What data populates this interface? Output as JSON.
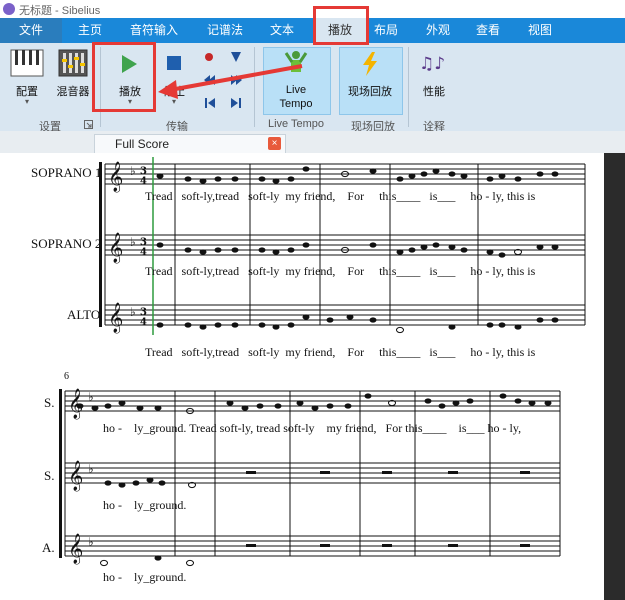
{
  "window": {
    "title": "无标题 - Sibelius"
  },
  "menubar": {
    "tabs": [
      {
        "label": "文件"
      },
      {
        "label": "主页"
      },
      {
        "label": "音符输入"
      },
      {
        "label": "记谱法"
      },
      {
        "label": "文本"
      },
      {
        "label": "播放"
      },
      {
        "label": "布局"
      },
      {
        "label": "外观"
      },
      {
        "label": "查看"
      },
      {
        "label": "视图"
      }
    ],
    "active": "播放"
  },
  "ribbon": {
    "config_label": "配置",
    "mixer_label": "混音器",
    "play_label": "播放",
    "stop_label": "停止",
    "live_tempo_label": "Live\nTempo",
    "live_playback_label": "现场回放",
    "performance_label": "性能",
    "groups": {
      "setup": "设置",
      "transport": "传输",
      "live_tempo": "Live Tempo",
      "live_playback": "现场回放",
      "interpretation": "诠释"
    }
  },
  "document": {
    "tab_label": "Full Score",
    "close_icon": "×"
  },
  "score": {
    "system1": {
      "instruments": [
        "SOPRANO 1",
        "SOPRANO 2",
        "ALTO"
      ],
      "lyrics": [
        "Tread   soft-ly,tread   soft-ly  my friend,    For     this____   is___     ho - ly, this is",
        "Tread   soft-ly,tread   soft-ly  my friend,    For     this____   is___     ho - ly, this is",
        "Tread   soft-ly,tread   soft-ly  my friend,    For     this____   is___     ho - ly, this is"
      ]
    },
    "system2": {
      "measure_number": "6",
      "instruments": [
        "S.",
        "S.",
        "A."
      ],
      "lyrics": [
        "ho -    ly_ground. Tread soft-ly, tread soft-ly    my friend,   For this____    is___ ho - ly,",
        "ho -    ly_ground.",
        "ho -    ly_ground."
      ]
    }
  },
  "colors": {
    "menubar": "#1a88d9",
    "ribbon": "#d9e6f1",
    "highlight": "#e53935",
    "playhead": "#2e9c3e"
  }
}
